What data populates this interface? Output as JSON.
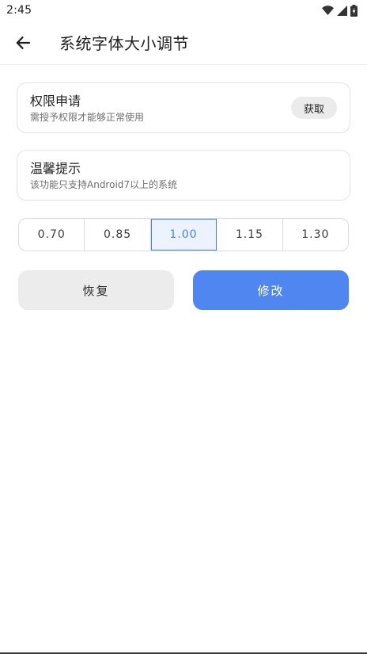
{
  "status_bar": {
    "time": "2:45",
    "icons": [
      "wifi-icon",
      "signal-icon",
      "battery-icon"
    ]
  },
  "app_bar": {
    "back_icon": "arrow-left-icon",
    "title": "系统字体大小调节"
  },
  "permission_card": {
    "title": "权限申请",
    "subtitle": "需授予权限才能够正常使用",
    "button_label": "获取"
  },
  "tip_card": {
    "title": "温馨提示",
    "subtitle": "该功能只支持Android7以上的系统"
  },
  "scale_options": {
    "items": [
      "0.70",
      "0.85",
      "1.00",
      "1.15",
      "1.30"
    ],
    "selected": "1.00"
  },
  "actions": {
    "reset_label": "恢复",
    "apply_label": "修改"
  },
  "colors": {
    "accent": "#4f86f0",
    "selected_text": "#4a83e8",
    "reset_bg": "#ececec"
  }
}
